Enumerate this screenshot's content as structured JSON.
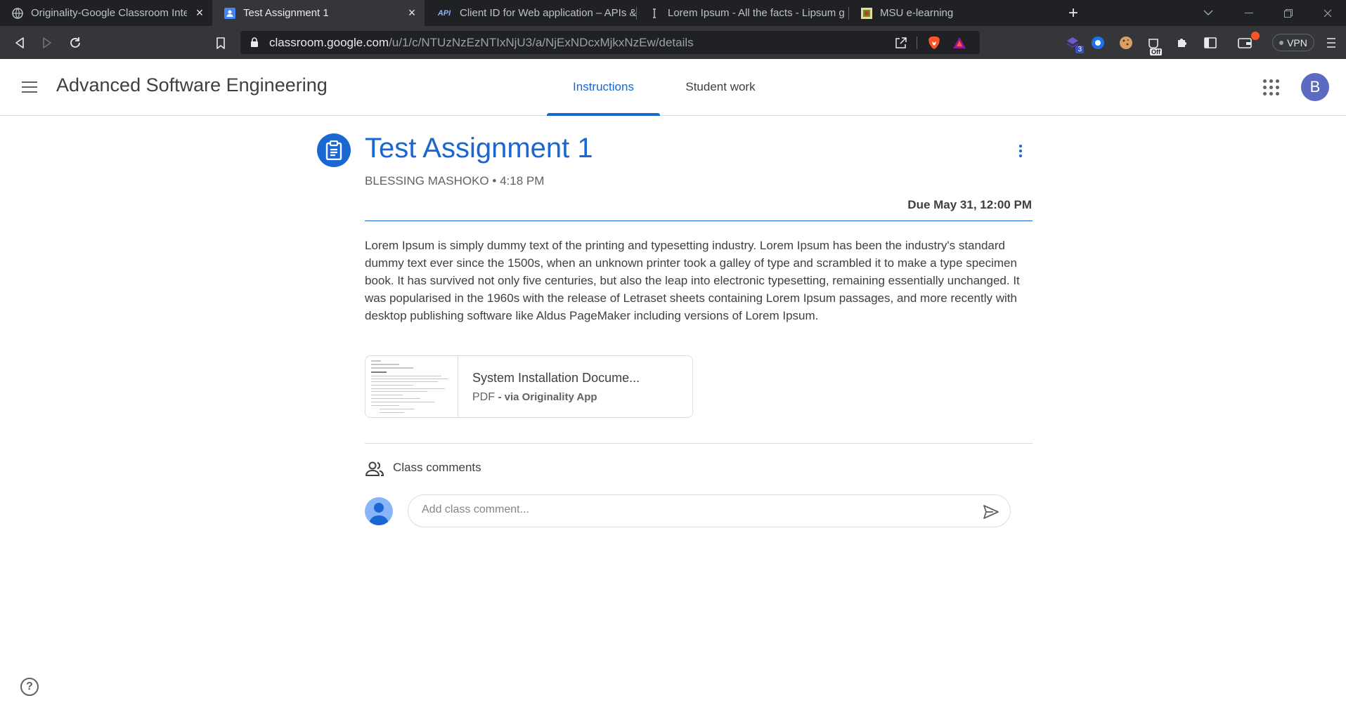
{
  "browser": {
    "tabs": [
      {
        "title": "Originality-Google Classroom Inte",
        "icon": "globe-icon",
        "active": false
      },
      {
        "title": "Test Assignment 1",
        "icon": "classroom-icon",
        "active": true
      },
      {
        "title": "Client ID for Web application – APIs &",
        "icon": "api-icon",
        "active": false
      },
      {
        "title": "Lorem Ipsum - All the facts - Lipsum g",
        "icon": "lipsum-icon",
        "active": false
      },
      {
        "title": "MSU e-learning",
        "icon": "msu-icon",
        "active": false
      }
    ],
    "api_favicon_text": "API",
    "url_host": "classroom.google.com",
    "url_path": "/u/1/c/NTUzNzEzNTIxNjU3/a/NjExNDcxMjkxNzEw/details",
    "extension_badge": "3",
    "off_badge": "Off",
    "vpn_label": "VPN"
  },
  "header": {
    "class_title": "Advanced Software Engineering",
    "tabs": [
      {
        "label": "Instructions",
        "active": true
      },
      {
        "label": "Student work",
        "active": false
      }
    ],
    "avatar_letter": "B"
  },
  "assignment": {
    "title": "Test Assignment 1",
    "author": "BLESSING MASHOKO",
    "separator": "•",
    "time": "4:18 PM",
    "due": "Due May 31, 12:00 PM",
    "description": "Lorem Ipsum is simply dummy text of the printing and typesetting industry. Lorem Ipsum has been the industry's standard dummy text ever since the 1500s, when an unknown printer took a galley of type and scrambled it to make a type specimen book. It has survived not only five centuries, but also the leap into electronic typesetting, remaining essentially unchanged. It was popularised in the 1960s with the release of Letraset sheets containing Lorem Ipsum passages, and more recently with desktop publishing software like Aldus PageMaker including versions of Lorem Ipsum.",
    "attachment": {
      "name": "System Installation Docume...",
      "type": "PDF",
      "via": "- via Originality App"
    }
  },
  "comments": {
    "label": "Class comments",
    "placeholder": "Add class comment..."
  },
  "colors": {
    "accent": "#1967d2",
    "browser_dark": "#202124",
    "browser_toolbar": "#35363a",
    "avatar": "#5c6bc0"
  }
}
